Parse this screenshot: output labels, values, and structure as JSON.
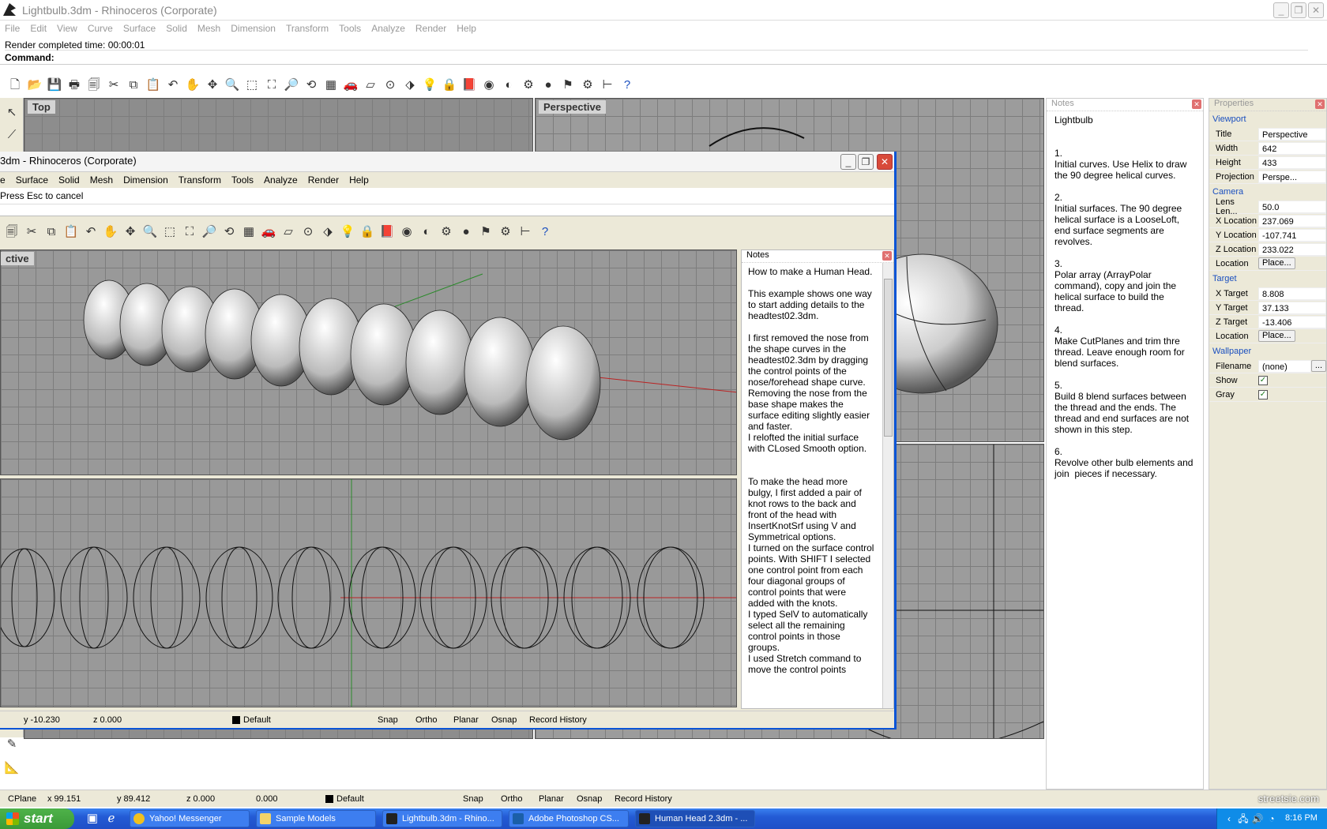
{
  "back_window": {
    "title": "Lightbulb.3dm - Rhinoceros (Corporate)",
    "menu": [
      "File",
      "Edit",
      "View",
      "Curve",
      "Surface",
      "Solid",
      "Mesh",
      "Dimension",
      "Transform",
      "Tools",
      "Analyze",
      "Render",
      "Help"
    ],
    "history_line": "Render completed time: 00:00:01",
    "command_label": "Command:",
    "viewport_top": "Top",
    "viewport_perspective": "Perspective"
  },
  "notes_back": {
    "title": "Notes",
    "text": "Lightbulb\n\n\n1.\nInitial curves. Use Helix to draw the 90 degree helical curves.\n\n2.\nInitial surfaces. The 90 degree helical surface is a LooseLoft, end surface segments are revolves.\n\n3.\nPolar array (ArrayPolar command), copy and join the helical surface to build the thread.\n\n4.\nMake CutPlanes and trim thre thread. Leave enough room for blend surfaces.\n\n5.\nBuild 8 blend surfaces between the thread and the ends. The thread and end surfaces are not shown in this step.\n\n6.\nRevolve other bulb elements and join  pieces if necessary."
  },
  "properties": {
    "title": "Properties",
    "viewport_section": "Viewport",
    "viewport": [
      {
        "k": "Title",
        "v": "Perspective"
      },
      {
        "k": "Width",
        "v": "642"
      },
      {
        "k": "Height",
        "v": "433"
      },
      {
        "k": "Projection",
        "v": "Perspe..."
      }
    ],
    "camera_section": "Camera",
    "camera": [
      {
        "k": "Lens Len...",
        "v": "50.0"
      },
      {
        "k": "X Location",
        "v": "237.069"
      },
      {
        "k": "Y Location",
        "v": "-107.741"
      },
      {
        "k": "Z Location",
        "v": "233.022"
      },
      {
        "k": "Location",
        "v": "Place..."
      }
    ],
    "target_section": "Target",
    "target": [
      {
        "k": "X Target",
        "v": "8.808"
      },
      {
        "k": "Y Target",
        "v": "37.133"
      },
      {
        "k": "Z Target",
        "v": "-13.406"
      },
      {
        "k": "Location",
        "v": "Place..."
      }
    ],
    "wallpaper_section": "Wallpaper",
    "wallpaper": [
      {
        "k": "Filename",
        "v": "(none)"
      },
      {
        "k": "Show",
        "v": ""
      },
      {
        "k": "Gray",
        "v": ""
      }
    ],
    "browse": "..."
  },
  "back_status": {
    "cplane": "CPlane",
    "x": "x 99.151",
    "y": "y 89.412",
    "z": "z 0.000",
    "dist": "0.000",
    "layer": "Default",
    "snap": "Snap",
    "ortho": "Ortho",
    "planar": "Planar",
    "osnap": "Osnap",
    "history": "Record History"
  },
  "front_window": {
    "title": "3dm - Rhinoceros (Corporate)",
    "menu": [
      "e",
      "Surface",
      "Solid",
      "Mesh",
      "Dimension",
      "Transform",
      "Tools",
      "Analyze",
      "Render",
      "Help"
    ],
    "history_line": "Press Esc to cancel",
    "viewport_persp": "ctive"
  },
  "notes_front": {
    "title": "Notes",
    "text": "How to make a Human Head.\n\nThis example shows one way to start adding details to the headtest02.3dm.\n\nI first removed the nose from the shape curves in the headtest02.3dm by dragging the control points of the nose/forehead shape curve.\nRemoving the nose from the base shape makes the surface editing slightly easier and faster.\nI relofted the initial surface with CLosed Smooth option.\n\n\nTo make the head more bulgy, I first added a pair of knot rows to the back and front of the head with InsertKnotSrf using V and Symmetrical options.\nI turned on the surface control points. With SHIFT I selected one control point from each four diagonal groups of control points that were added with the knots.\nI typed SelV to automatically select all the remaining control points in those groups.\nI used Stretch command to move the control points"
  },
  "front_status": {
    "y": "y -10.230",
    "z": "z 0.000",
    "layer": "Default",
    "snap": "Snap",
    "ortho": "Ortho",
    "planar": "Planar",
    "osnap": "Osnap",
    "history": "Record History"
  },
  "taskbar": {
    "start": "start",
    "tasks": [
      "Yahoo! Messenger",
      "Sample Models",
      "Lightbulb.3dm - Rhino...",
      "Adobe Photoshop CS...",
      "Human Head 2.3dm - ..."
    ],
    "clock": "8:16 PM",
    "watermark": "streetsie.com"
  }
}
